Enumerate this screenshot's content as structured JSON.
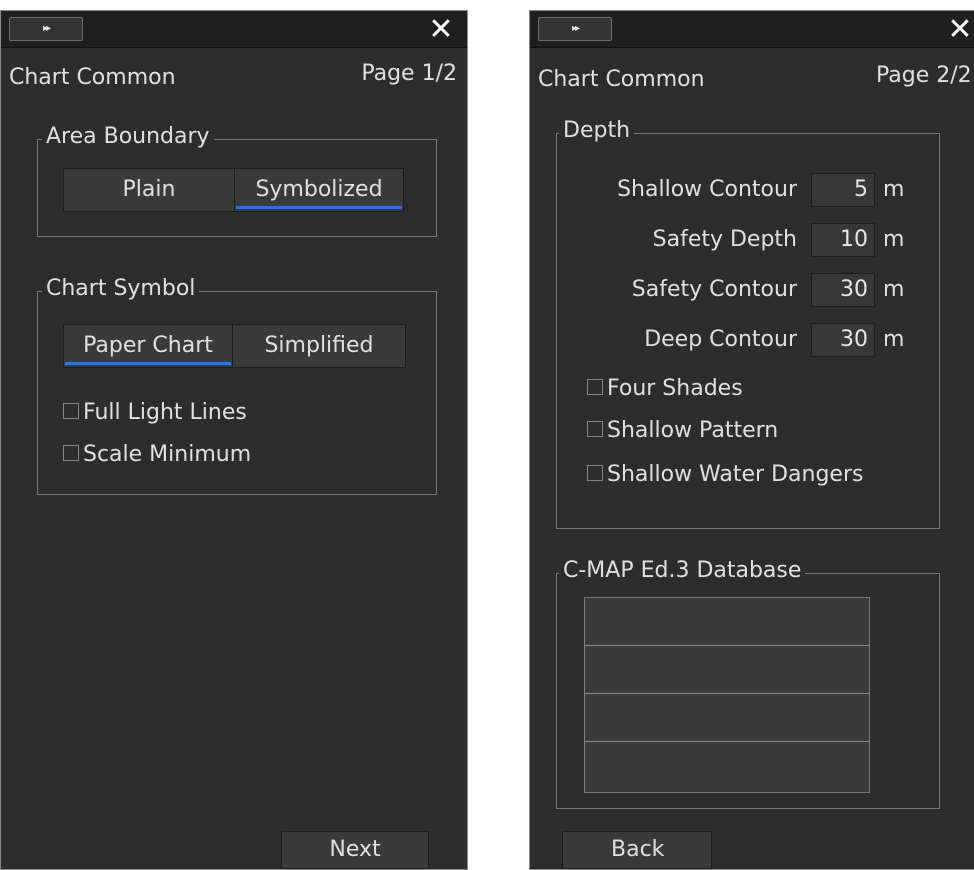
{
  "left_panel": {
    "expand_label": "▸▸",
    "close_label": "✕",
    "title": "Chart Common",
    "page": "Page 1/2",
    "area_boundary": {
      "legend": "Area Boundary",
      "options": [
        "Plain",
        "Symbolized"
      ],
      "selected": "Symbolized"
    },
    "chart_symbol": {
      "legend": "Chart Symbol",
      "options": [
        "Paper Chart",
        "Simplified"
      ],
      "selected": "Paper Chart",
      "checkboxes": [
        {
          "label": "Full Light Lines",
          "checked": false
        },
        {
          "label": "Scale Minimum",
          "checked": false
        }
      ]
    },
    "next_label": "Next"
  },
  "right_panel": {
    "expand_label": "▸▸",
    "close_label": "✕",
    "title": "Chart Common",
    "page": "Page 2/2",
    "depth": {
      "legend": "Depth",
      "fields": [
        {
          "label": "Shallow Contour",
          "value": "5",
          "unit": "m"
        },
        {
          "label": "Safety Depth",
          "value": "10",
          "unit": "m"
        },
        {
          "label": "Safety Contour",
          "value": "30",
          "unit": "m"
        },
        {
          "label": "Deep Contour",
          "value": "30",
          "unit": "m"
        }
      ],
      "checkboxes": [
        {
          "label": "Four Shades",
          "checked": false
        },
        {
          "label": "Shallow Pattern",
          "checked": false
        },
        {
          "label": "Shallow Water Dangers",
          "checked": false
        }
      ]
    },
    "database": {
      "legend": "C-MAP Ed.3 Database",
      "rows": [
        "",
        "",
        "",
        ""
      ]
    },
    "back_label": "Back"
  },
  "colors": {
    "panel_bg": "#2d2d2d",
    "topbar_bg": "#1f1f1f",
    "selected_underline": "#2f6fd6",
    "text": "#e0e0e0"
  }
}
